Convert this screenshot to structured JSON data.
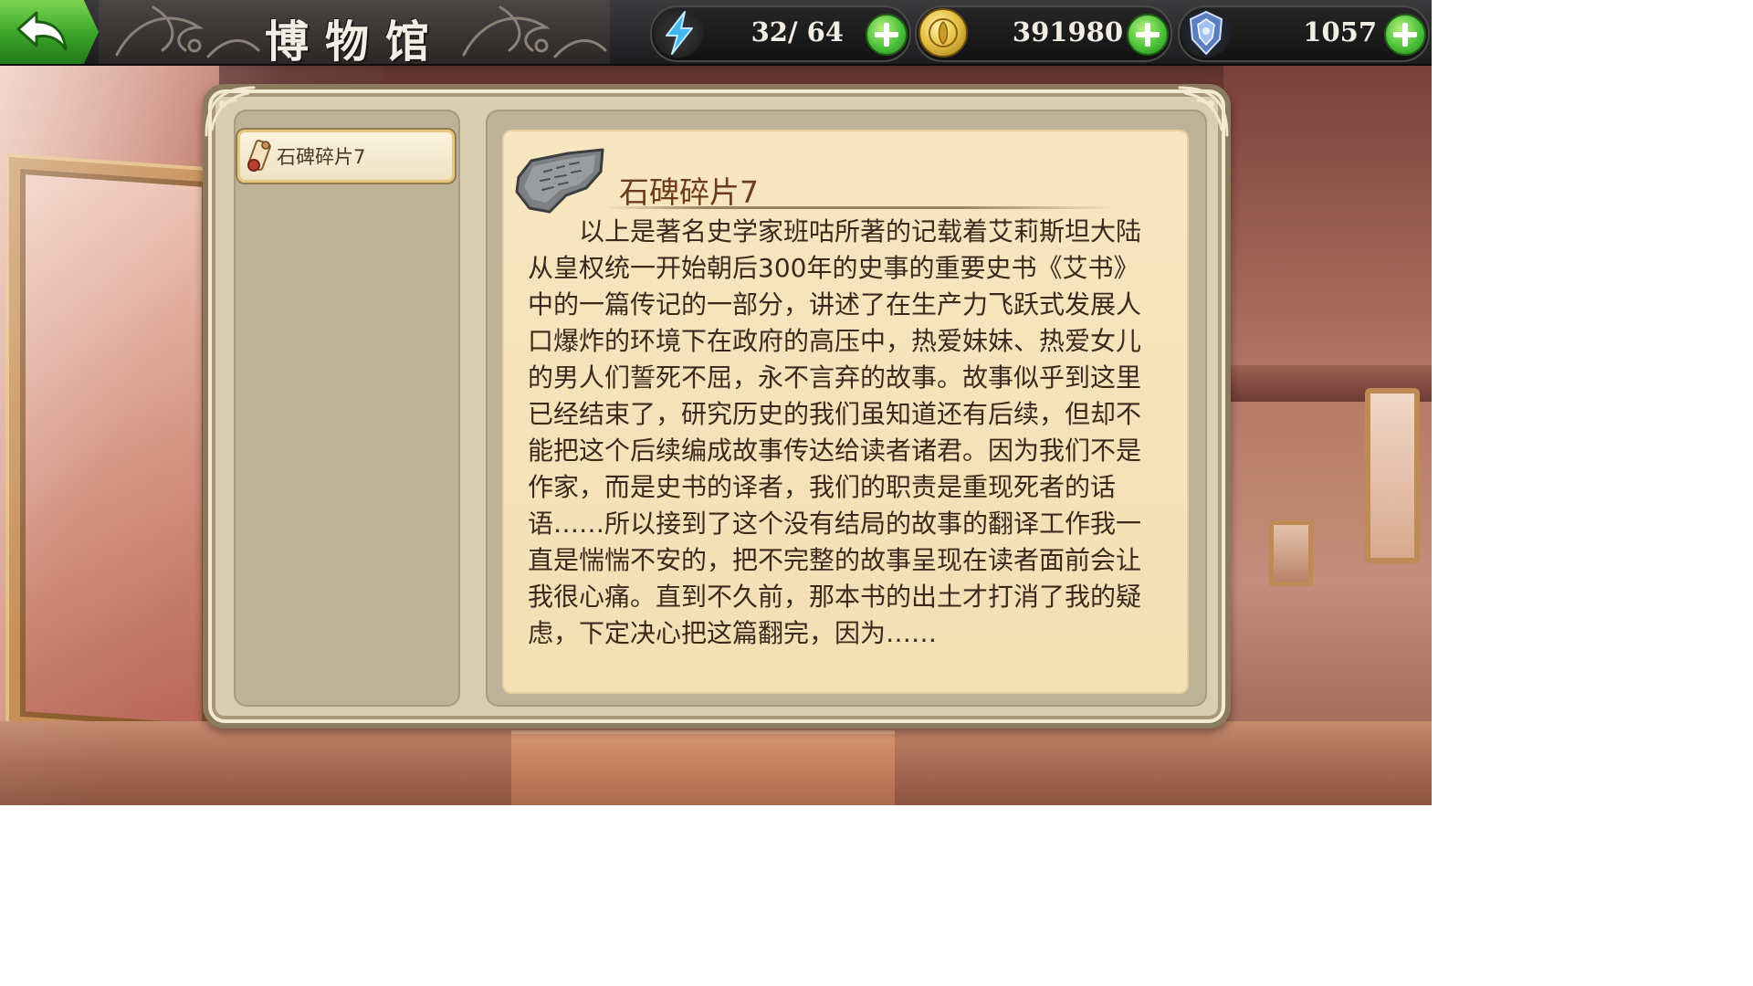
{
  "header": {
    "back_label": "",
    "title": "博物馆"
  },
  "resources": {
    "stamina": {
      "icon": "lightning-icon",
      "value": "32/ 64"
    },
    "gold": {
      "icon": "gold-coin-icon",
      "value": "391980"
    },
    "gems": {
      "icon": "crystal-shield-icon",
      "value": "1057"
    }
  },
  "collection": {
    "items": [
      {
        "label": "石碑碎片7",
        "icon": "scroll-icon",
        "selected": true
      }
    ]
  },
  "detail": {
    "image": "stone-tablet-fragment-icon",
    "title": "石碑碎片7",
    "description": "以上是著名史学家班咕所著的记载着艾莉斯坦大陆从皇权统一开始朝后300年的史事的重要史书《艾书》中的一篇传记的一部分，讲述了在生产力飞跃式发展人口爆炸的环境下在政府的高压中，热爱妹妹、热爱女儿的男人们誓死不屈，永不言弃的故事。故事似乎到这里已经结束了，研究历史的我们虽知道还有后续，但却不能把这个后续编成故事传达给读者诸君。因为我们不是作家，而是史书的译者，我们的职责是重现死者的话语……所以接到了这个没有结局的故事的翻译工作我一直是惴惴不安的，把不完整的故事呈现在读者面前会让我很心痛。直到不久前，那本书的出土才打消了我的疑虑，下定决心把这篇翻完，因为……"
  },
  "colors": {
    "accent_green": "#39a428",
    "title_brown": "#6b3c1b",
    "card_bg": "#f7e6c0"
  }
}
